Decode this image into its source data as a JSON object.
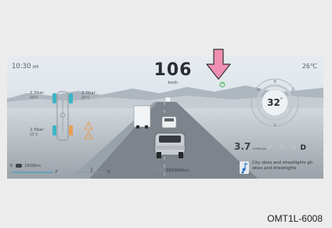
{
  "cluster": {
    "time": "10:30",
    "time_suffix": "AM",
    "outside_temp": "26℃",
    "speed": "106",
    "speed_unit": "km/h",
    "compass_temp": "32",
    "tires": [
      {
        "pressure": "2.5bar",
        "temp": "25℃"
      },
      {
        "pressure": "2.5bar",
        "temp": "25℃"
      },
      {
        "pressure": "2.5bar",
        "temp": "25℃"
      }
    ],
    "fuel_range": "1420km",
    "fuel_empty": "E",
    "gauge_low": "F",
    "gauge_high": "H",
    "power_value": "3.7",
    "power_unit": "x1000rpm",
    "gears_inactive": "P R N",
    "gear_active": "D",
    "odometer_label": "ODO",
    "odometer": "889999km",
    "music_text": "City skies and streetlights gh skies and streetlights"
  },
  "caption": "OMT1L-6008",
  "colors": {
    "arrow": "#f08fb1",
    "indicator": "#3fb75b",
    "compass_ring": "#aeb6bd",
    "music_icon": "#2e6fc5"
  }
}
